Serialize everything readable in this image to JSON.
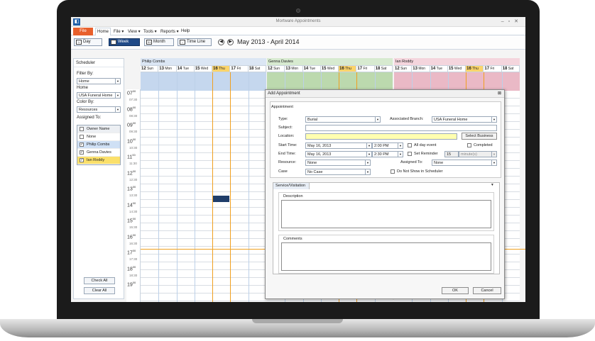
{
  "window": {
    "title": "Mortware Appointments"
  },
  "ribbon": {
    "file_label": "File",
    "home_label": "Home",
    "menus": [
      "File ▾",
      "View ▾",
      "Tools ▾",
      "Reports ▾",
      "Help"
    ]
  },
  "toolbar": {
    "views": [
      {
        "label": "Day",
        "icon": "1"
      },
      {
        "label": "Week",
        "icon": "7"
      },
      {
        "label": "Month",
        "icon": "31"
      },
      {
        "label": "Time Line",
        "icon": "::"
      }
    ],
    "active_view": "Week",
    "range_title": "May 2013 - April 2014"
  },
  "sidebar": {
    "title": "Scheduler",
    "filter_by_label": "Filter By:",
    "filter_by_value": "Home",
    "home_label": "Home",
    "home_value": "USA Funeral Home",
    "color_by_label": "Color By:",
    "color_by_value": "Resources",
    "assigned_to_label": "Assigned To:",
    "owner_header": "Owner Name",
    "owners": [
      {
        "name": "None",
        "checked": false,
        "style": ""
      },
      {
        "name": "Philip Combs",
        "checked": true,
        "style": "sel"
      },
      {
        "name": "Genna Davies",
        "checked": true,
        "style": ""
      },
      {
        "name": "Ian Roddy",
        "checked": true,
        "style": "yel"
      }
    ],
    "check_all_label": "Check All",
    "clear_all_label": "Clear All"
  },
  "times": [
    {
      "hour": "07",
      "half": "07:30"
    },
    {
      "hour": "08",
      "half": "08:30"
    },
    {
      "hour": "09",
      "half": "09:30"
    },
    {
      "hour": "10",
      "half": "10:30"
    },
    {
      "hour": "11",
      "half": "11:30"
    },
    {
      "hour": "12",
      "half": "12:30"
    },
    {
      "hour": "13",
      "half": "13:30"
    },
    {
      "hour": "14",
      "half": "14:30"
    },
    {
      "hour": "15",
      "half": "15:30"
    },
    {
      "hour": "16",
      "half": "16:30"
    },
    {
      "hour": "17",
      "half": "17:30"
    },
    {
      "hour": "18",
      "half": "18:30"
    },
    {
      "hour": "19",
      "half": ""
    }
  ],
  "minutes_mark": "00",
  "days": [
    {
      "num": "12",
      "name": "Sun"
    },
    {
      "num": "13",
      "name": "Mon"
    },
    {
      "num": "14",
      "name": "Tue"
    },
    {
      "num": "15",
      "name": "Wed"
    },
    {
      "num": "16",
      "name": "Thu",
      "today": true
    },
    {
      "num": "17",
      "name": "Fri"
    },
    {
      "num": "18",
      "name": "Sat"
    }
  ],
  "owner_columns": [
    {
      "name": "Philip Combs",
      "header_color": "#dbe6f4",
      "body_color": "#c5d7ee",
      "tint": "#eaf1fa"
    },
    {
      "name": "Genna Davies",
      "header_color": "#d7ead0",
      "body_color": "#bcd9ae",
      "tint": "#eef6ea"
    },
    {
      "name": "Ian Roddy",
      "header_color": "#f4d5dd",
      "body_color": "#eab9c6",
      "tint": "#fbecf0"
    }
  ],
  "dialog": {
    "title": "Add Appointment",
    "close": "⊠",
    "group_label": "Appointment",
    "type_label": "Type:",
    "type_value": "Burial",
    "branch_label": "Associated Branch:",
    "branch_value": "USA Funeral Home",
    "subject_label": "Subject:",
    "subject_value": "",
    "location_label": "Location:",
    "location_value": "",
    "select_business_label": "Select Business",
    "start_label": "Start Time:",
    "start_date": "May 16, 2013",
    "start_time": "2:00 PM",
    "end_label": "End Time:",
    "end_date": "May 16, 2013",
    "end_time": "2:30 PM",
    "all_day_label": "All day event",
    "completed_label": "Completed",
    "reminder_label": "Set Reminder",
    "reminder_value": "15",
    "reminder_unit": "minute(s)",
    "resource_label": "Resource:",
    "resource_value": "None",
    "assigned_label": "Assigned To:",
    "assigned_value": "None",
    "case_label": "Case",
    "case_value": "No Case",
    "no_show_label": "Do Not Show in Scheduler",
    "tab_label": "Service/Visitation",
    "tab_collapse": "▾",
    "description_label": "Description",
    "comments_label": "Comments",
    "ok_label": "OK",
    "cancel_label": "Cancel"
  }
}
